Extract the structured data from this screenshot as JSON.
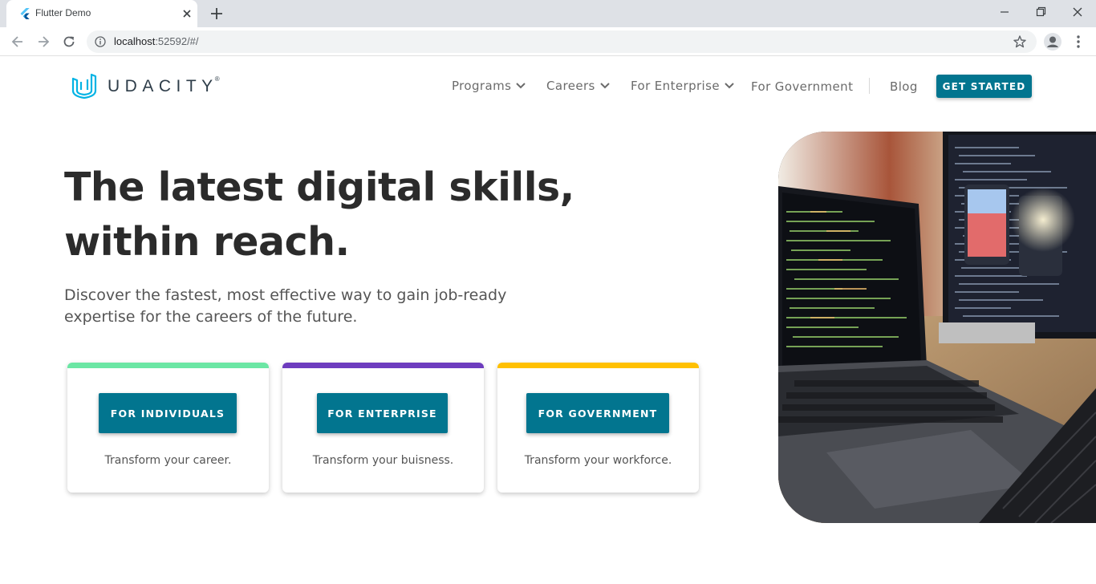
{
  "browser": {
    "tab_title": "Flutter Demo",
    "url_host": "localhost",
    "url_rest": ":52592/#/",
    "icons": [
      "flutter-icon",
      "close-icon",
      "plus-icon",
      "minimize-icon",
      "restore-icon",
      "window-close-icon",
      "back-icon",
      "forward-icon",
      "reload-icon",
      "info-icon",
      "star-icon",
      "profile-icon",
      "menu-icon"
    ]
  },
  "header": {
    "logo_text": "UDACITY",
    "logo_reg": "®",
    "nav": {
      "programs": "Programs",
      "careers": "Careers",
      "enterprise": "For Enterprise",
      "government": "For Government",
      "blog": "Blog"
    },
    "cta": "GET STARTED"
  },
  "hero": {
    "title_line1": "The latest digital skills,",
    "title_line2": "within reach.",
    "subtitle_line1": "Discover the fastest, most effective way to gain job-ready",
    "subtitle_line2": "expertise for the careers of the future."
  },
  "cards": [
    {
      "button": "FOR INDIVIDUALS",
      "description": "Transform your career.",
      "accent": "#6be6a4"
    },
    {
      "button": "FOR ENTERPRISE",
      "description": "Transform your buisness.",
      "accent": "#6d3cbe"
    },
    {
      "button": "FOR GOVERNMENT",
      "description": "Transform your workforce.",
      "accent": "#ffc000"
    }
  ],
  "colors": {
    "brand": "#02758f",
    "logo": "#02b3e4"
  }
}
